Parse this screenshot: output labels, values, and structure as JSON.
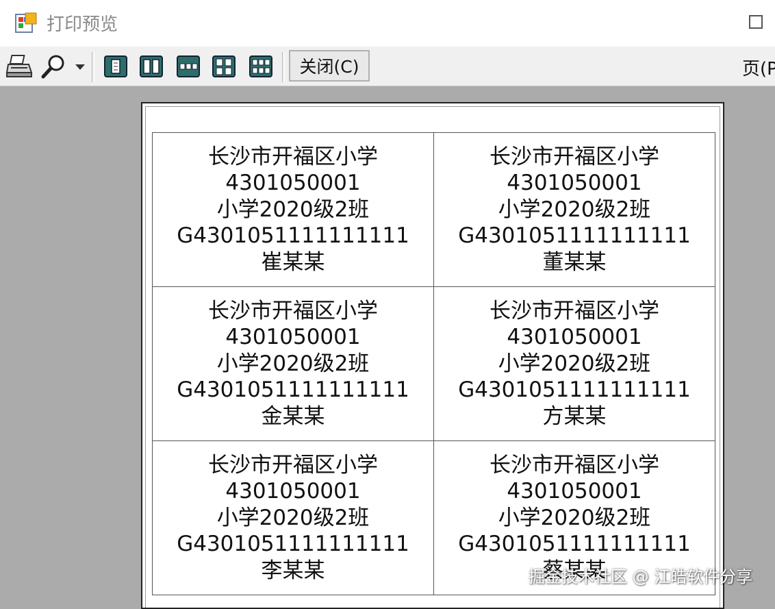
{
  "window": {
    "title": "打印预览"
  },
  "toolbar": {
    "close_label": "关闭(C)",
    "page_label": "页(P",
    "icons": [
      "print-icon",
      "zoom-icon",
      "dropdown-arrow-icon",
      "one-page-icon",
      "two-pages-icon",
      "three-pages-icon",
      "four-pages-icon",
      "six-pages-icon"
    ]
  },
  "labels": [
    {
      "school": "长沙市开福区小学",
      "code": "4301050001",
      "class": "小学2020级2班",
      "student_id": "G4301051111111111",
      "name": "崔某某"
    },
    {
      "school": "长沙市开福区小学",
      "code": "4301050001",
      "class": "小学2020级2班",
      "student_id": "G4301051111111111",
      "name": "董某某"
    },
    {
      "school": "长沙市开福区小学",
      "code": "4301050001",
      "class": "小学2020级2班",
      "student_id": "G4301051111111111",
      "name": "金某某"
    },
    {
      "school": "长沙市开福区小学",
      "code": "4301050001",
      "class": "小学2020级2班",
      "student_id": "G4301051111111111",
      "name": "方某某"
    },
    {
      "school": "长沙市开福区小学",
      "code": "4301050001",
      "class": "小学2020级2班",
      "student_id": "G4301051111111111",
      "name": "李某某"
    },
    {
      "school": "长沙市开福区小学",
      "code": "4301050001",
      "class": "小学2020级2班",
      "student_id": "G4301051111111111",
      "name": "蔡某某"
    }
  ],
  "watermark": "掘金技术社区 @ 江皓软件分享",
  "colors": {
    "window_bg": "#ababab",
    "toolbar_bg": "#f0f0f0",
    "icon_teal": "#2e6e6a"
  }
}
